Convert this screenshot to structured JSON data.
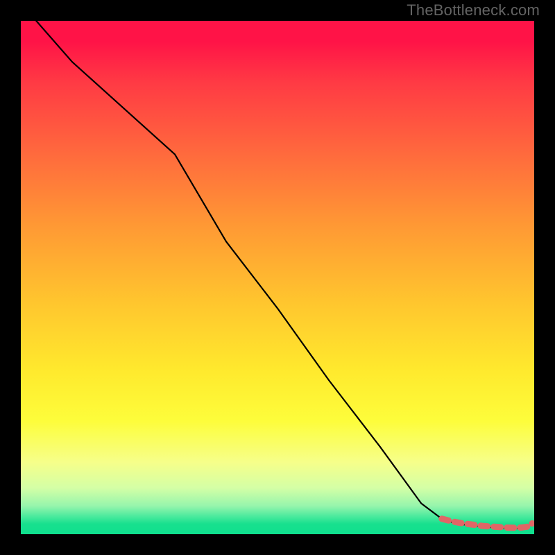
{
  "watermark": "TheBottleneck.com",
  "colors": {
    "frame": "#000000",
    "watermark": "#646464",
    "curve": "#000000",
    "marker_fill": "#e06666",
    "marker_stroke": "#c44b4b",
    "gradient_stops": [
      "#ff1347",
      "#ff6a3d",
      "#ffc62e",
      "#fdfd3b",
      "#96f5ac",
      "#0fe08e"
    ]
  },
  "chart_data": {
    "type": "line",
    "title": "",
    "xlabel": "",
    "ylabel": "",
    "xlim": [
      0,
      100
    ],
    "ylim": [
      0,
      100
    ],
    "series": [
      {
        "name": "bottleneck-curve",
        "x": [
          3,
          10,
          20,
          30,
          40,
          50,
          60,
          70,
          78,
          82,
          85,
          88,
          90,
          92,
          94,
          96,
          98,
          99.5
        ],
        "y": [
          100,
          92,
          83,
          74,
          57,
          44,
          30,
          17,
          6,
          3,
          2,
          1.7,
          1.5,
          1.3,
          1.2,
          1.1,
          1.2,
          2.0
        ]
      }
    ],
    "markers": {
      "name": "highlight-segment",
      "x": [
        82,
        84,
        85.5,
        87,
        88.5,
        90,
        91.5,
        93,
        94.5,
        96,
        97.5,
        99,
        99.6
      ],
      "y": [
        3.0,
        2.5,
        2.2,
        2.0,
        1.8,
        1.6,
        1.5,
        1.4,
        1.3,
        1.25,
        1.3,
        1.5,
        2.1
      ]
    }
  }
}
